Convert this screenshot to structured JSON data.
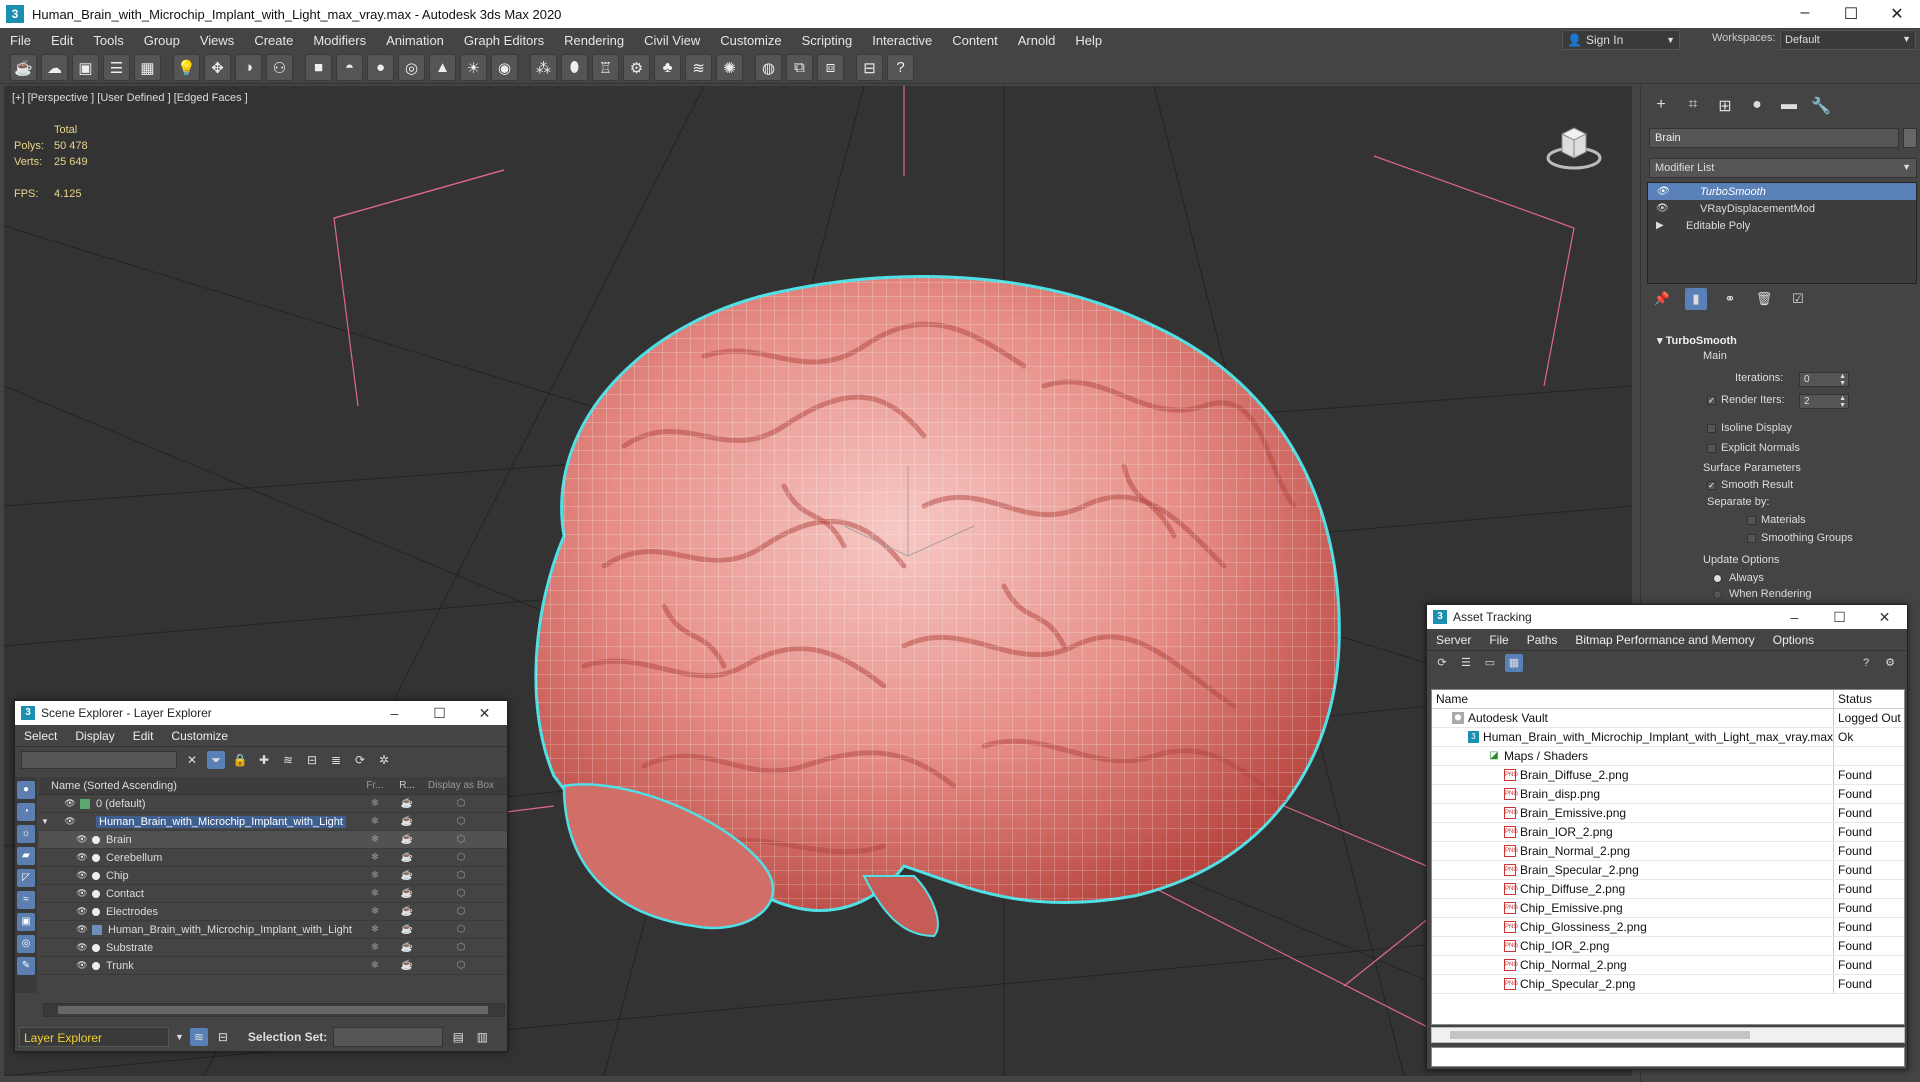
{
  "window": {
    "title": "Human_Brain_with_Microchip_Implant_with_Light_max_vray.max - Autodesk 3ds Max 2020"
  },
  "menu": [
    "File",
    "Edit",
    "Tools",
    "Group",
    "Views",
    "Create",
    "Modifiers",
    "Animation",
    "Graph Editors",
    "Rendering",
    "Civil View",
    "Customize",
    "Scripting",
    "Interactive",
    "Content",
    "Arnold",
    "Help"
  ],
  "account": {
    "sign_in": "Sign In",
    "workspaces_label": "Workspaces:",
    "workspace": "Default"
  },
  "viewport": {
    "label": "[+] [Perspective ] [User Defined ] [Edged Faces ]",
    "stats": {
      "total_label": "Total",
      "polys_label": "Polys:",
      "polys": "50 478",
      "verts_label": "Verts:",
      "verts": "25 649",
      "fps_label": "FPS:",
      "fps": "4.125"
    }
  },
  "command_panel": {
    "object_name": "Brain",
    "modifier_list": "Modifier List",
    "stack": [
      "TurboSmooth",
      "VRayDisplacementMod",
      "Editable Poly"
    ],
    "rollout": {
      "title": "TurboSmooth",
      "main_label": "Main",
      "iterations_label": "Iterations:",
      "iterations": "0",
      "render_iters_label": "Render Iters:",
      "render_iters": "2",
      "isoline": "Isoline Display",
      "explicit_normals": "Explicit Normals",
      "surface_params": "Surface Parameters",
      "smooth_result": "Smooth Result",
      "separate_by": "Separate by:",
      "materials": "Materials",
      "smoothing_groups": "Smoothing Groups",
      "update_options": "Update Options",
      "always": "Always",
      "when_rendering": "When Rendering"
    }
  },
  "scene_explorer": {
    "title": "Scene Explorer - Layer Explorer",
    "menu": [
      "Select",
      "Display",
      "Edit",
      "Customize"
    ],
    "columns": {
      "name": "Name (Sorted Ascending)",
      "frozen": "Fr...",
      "render": "R...",
      "box": "Display as Box"
    },
    "rows": [
      {
        "name": "0 (default)",
        "level": 0,
        "type": "layer"
      },
      {
        "name": "Human_Brain_with_Microchip_Implant_with_Light",
        "level": 0,
        "type": "layer-selected"
      },
      {
        "name": "Brain",
        "level": 1,
        "type": "object"
      },
      {
        "name": "Cerebellum",
        "level": 1,
        "type": "object"
      },
      {
        "name": "Chip",
        "level": 1,
        "type": "object"
      },
      {
        "name": "Contact",
        "level": 1,
        "type": "object"
      },
      {
        "name": "Electrodes",
        "level": 1,
        "type": "object"
      },
      {
        "name": "Human_Brain_with_Microchip_Implant_with_Light",
        "level": 1,
        "type": "group"
      },
      {
        "name": "Substrate",
        "level": 1,
        "type": "object"
      },
      {
        "name": "Trunk",
        "level": 1,
        "type": "object"
      }
    ],
    "layer_box": "Layer Explorer",
    "selection_set_label": "Selection Set:"
  },
  "asset_tracking": {
    "title": "Asset Tracking",
    "menu": [
      "Server",
      "File",
      "Paths",
      "Bitmap Performance and Memory",
      "Options"
    ],
    "columns": {
      "name": "Name",
      "status": "Status"
    },
    "rows": [
      {
        "name": "Autodesk Vault",
        "status": "Logged Out",
        "level": 0,
        "icon": "vault"
      },
      {
        "name": "Human_Brain_with_Microchip_Implant_with_Light_max_vray.max",
        "status": "Ok",
        "level": 1,
        "icon": "max"
      },
      {
        "name": "Maps / Shaders",
        "status": "",
        "level": 2,
        "icon": "maps"
      },
      {
        "name": "Brain_Diffuse_2.png",
        "status": "Found",
        "level": 3,
        "icon": "png"
      },
      {
        "name": "Brain_disp.png",
        "status": "Found",
        "level": 3,
        "icon": "png"
      },
      {
        "name": "Brain_Emissive.png",
        "status": "Found",
        "level": 3,
        "icon": "png"
      },
      {
        "name": "Brain_IOR_2.png",
        "status": "Found",
        "level": 3,
        "icon": "png"
      },
      {
        "name": "Brain_Normal_2.png",
        "status": "Found",
        "level": 3,
        "icon": "png"
      },
      {
        "name": "Brain_Specular_2.png",
        "status": "Found",
        "level": 3,
        "icon": "png"
      },
      {
        "name": "Chip_Diffuse_2.png",
        "status": "Found",
        "level": 3,
        "icon": "png"
      },
      {
        "name": "Chip_Emissive.png",
        "status": "Found",
        "level": 3,
        "icon": "png"
      },
      {
        "name": "Chip_Glossiness_2.png",
        "status": "Found",
        "level": 3,
        "icon": "png"
      },
      {
        "name": "Chip_IOR_2.png",
        "status": "Found",
        "level": 3,
        "icon": "png"
      },
      {
        "name": "Chip_Normal_2.png",
        "status": "Found",
        "level": 3,
        "icon": "png"
      },
      {
        "name": "Chip_Specular_2.png",
        "status": "Found",
        "level": 3,
        "icon": "png"
      }
    ]
  },
  "colors": {
    "accent": "#5a80b8",
    "brain": "#e07a74",
    "selection_outline": "#4fe0e6",
    "stats": "#e8d58a"
  }
}
